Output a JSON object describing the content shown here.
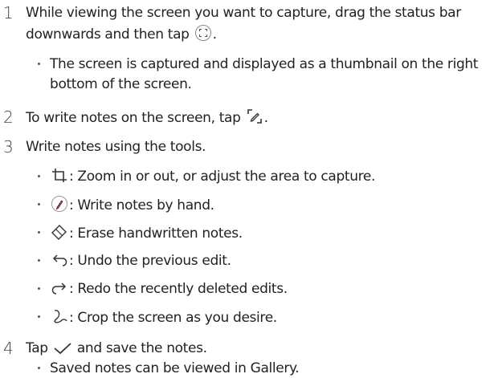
{
  "steps": [
    {
      "number": "1",
      "text_line1": "While viewing the screen you want to capture, drag the status bar",
      "text_line2": "downwards and then tap",
      "text_end": ".",
      "icon": "capture-button-icon",
      "bullets": [
        {
          "line1": "The screen is captured and displayed as a thumbnail on the right",
          "line2": "bottom of the screen."
        }
      ]
    },
    {
      "number": "2",
      "text": "To write notes on the screen, tap",
      "text_end": ".",
      "icon": "edit-pen-icon"
    },
    {
      "number": "3",
      "text": "Write notes using the tools.",
      "tools": [
        {
          "icon": "crop-icon",
          "text": ": Zoom in or out, or adjust the area to capture."
        },
        {
          "icon": "pen-icon",
          "text": ": Write notes by hand."
        },
        {
          "icon": "eraser-icon",
          "text": ": Erase handwritten notes."
        },
        {
          "icon": "undo-icon",
          "text": ": Undo the previous edit."
        },
        {
          "icon": "redo-icon",
          "text": ": Redo the recently deleted edits."
        },
        {
          "icon": "freeform-crop-icon",
          "text": ": Crop the screen as you desire."
        }
      ]
    },
    {
      "number": "4",
      "text_before": "Tap",
      "text_after": "and save the notes.",
      "icon": "checkmark-icon",
      "bullets": [
        {
          "text": "Saved notes can be viewed in Gallery."
        }
      ]
    }
  ],
  "colors": {
    "text": "#222222",
    "step_number": "#444444",
    "pen_accent": "#d9354a"
  }
}
